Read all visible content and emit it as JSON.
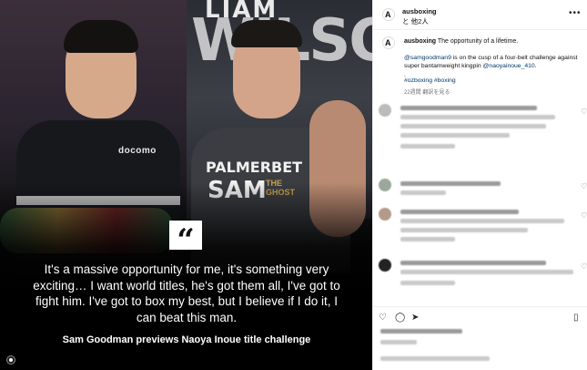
{
  "media": {
    "poster_top": "LIAM",
    "poster_big": "WILSO",
    "left_fighter_logo": "docomo",
    "shirt_brand": "PALMERBET",
    "shirt_name": "SAM",
    "shirt_sub": "THE GHOST",
    "quote_mark": "“",
    "quote": "It's a massive opportunity for me, it's something very exciting… I want world titles, he's got them all, I've got to fight him. I've got to box my best, but I believe if I do it, I can beat this man.",
    "caption": "Sam Goodman previews Naoya Inoue title challenge"
  },
  "header": {
    "username": "ausboxing",
    "collab": "と 他2人",
    "more_icon": "more-horizontal-icon"
  },
  "post_caption": {
    "username": "ausboxing",
    "headline": "The opportunity of a lifetime.",
    "mention1": "@samgoodman9",
    "body_mid": " is on the cusp of a four-belt challenge against super bantamweight kingpin ",
    "mention2": "@naoyainoue_410",
    "body_end": ".",
    "dot": ".",
    "hashtags": "#ozboxing #boxing",
    "meta": "22週間   翻訳を見る"
  },
  "comments": [
    {
      "lines": 3
    },
    {
      "lines": 1
    },
    {
      "lines": 2
    },
    {
      "lines": 2
    }
  ],
  "actions": {
    "like_icon": "heart-icon",
    "comment_icon": "comment-icon",
    "share_icon": "share-icon",
    "bookmark_icon": "bookmark-icon"
  }
}
